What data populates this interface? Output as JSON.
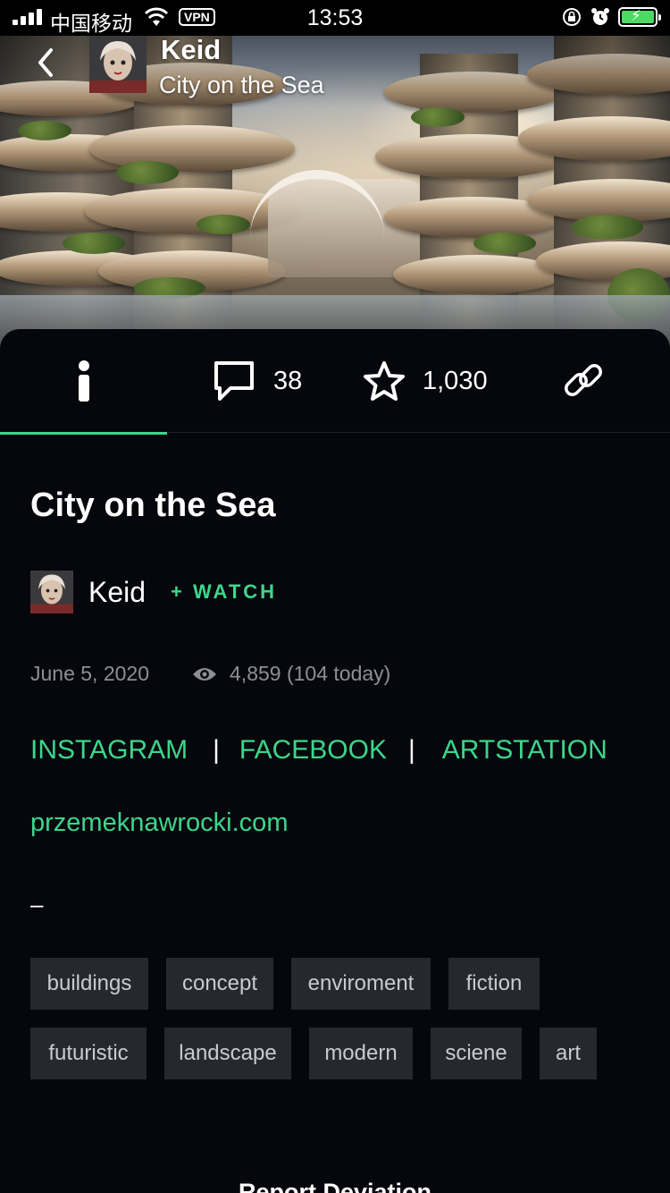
{
  "status_bar": {
    "carrier": "中国移动",
    "vpn": "VPN",
    "time": "13:53"
  },
  "header": {
    "author": "Keid",
    "title": "City on the Sea"
  },
  "tabs": {
    "comments_count": "38",
    "favourites_count": "1,030",
    "active": "info",
    "accent_color": "#3dd68c"
  },
  "deviation": {
    "title": "City on the Sea",
    "author": "Keid",
    "watch_label": "+ WATCH",
    "date": "June 5, 2020",
    "views": "4,859 (104 today)"
  },
  "description": {
    "links": [
      "INSTAGRAM",
      "FACEBOOK",
      "ARTSTATION"
    ],
    "separator": "|",
    "website": "przemeknawrocki.com",
    "dash": "–"
  },
  "tags": [
    "buildings",
    "concept",
    "enviroment",
    "fiction",
    "futuristic",
    "landscape",
    "modern",
    "sciene",
    "art"
  ],
  "footer": {
    "report_label": "Report Deviation"
  }
}
